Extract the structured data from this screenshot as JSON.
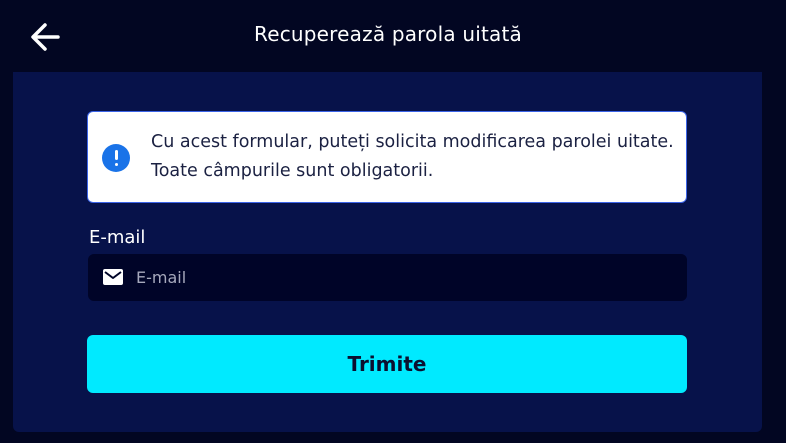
{
  "header": {
    "title": "Recuperează parola uitată",
    "back_icon": "arrow-left-icon"
  },
  "alert": {
    "icon": "exclamation-circle-icon",
    "text": "Cu acest formular, puteți solicita modificarea parolei uitate. Toate câmpurile sunt obligatorii."
  },
  "form": {
    "email_label": "E-mail",
    "email_placeholder": "E-mail",
    "email_icon": "envelope-icon",
    "submit_label": "Trimite"
  },
  "colors": {
    "page_background": "#020622",
    "panel_background": "#07124a",
    "input_background": "#000428",
    "accent": "#00eaff",
    "alert_border": "#3b64e8",
    "info_icon": "#1a73e8"
  }
}
